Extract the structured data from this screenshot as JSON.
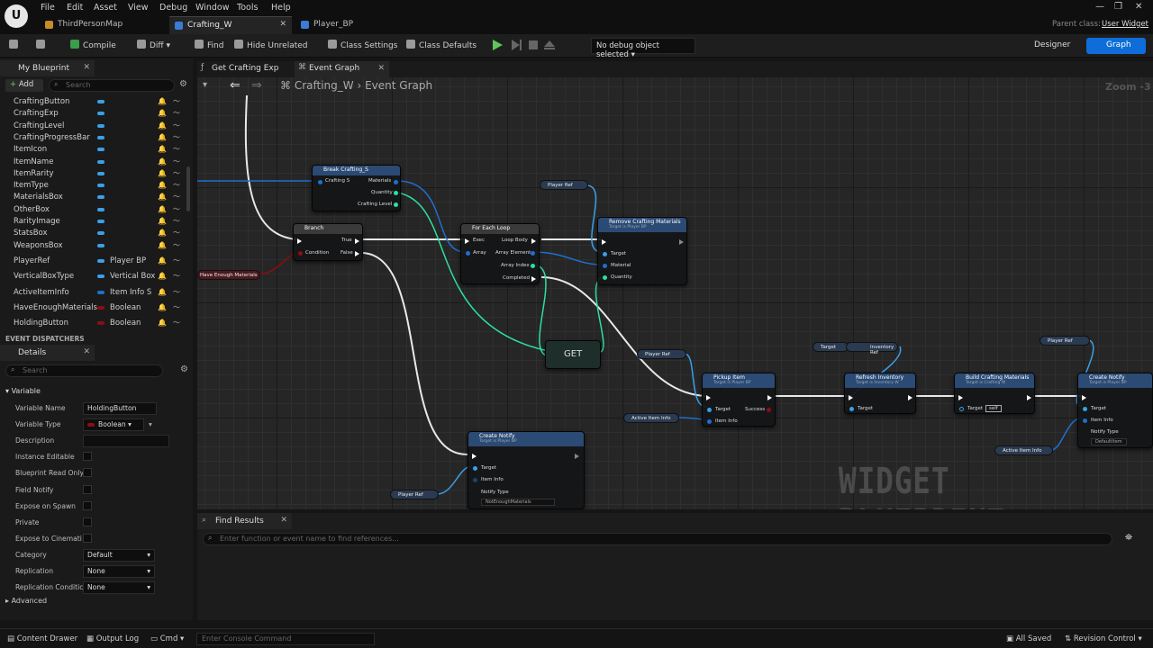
{
  "menu": [
    "File",
    "Edit",
    "Asset",
    "View",
    "Debug",
    "Window",
    "Tools",
    "Help"
  ],
  "tabs": [
    {
      "label": "ThirdPersonMap",
      "color": "#c58a2a"
    },
    {
      "label": "Crafting_W",
      "color": "#3a7bd5"
    },
    {
      "label": "Player_BP",
      "color": "#3a7bd5"
    }
  ],
  "parent_class_label": "Parent class:",
  "parent_class_value": "User Widget",
  "toolbar": {
    "compile": "Compile",
    "diff": "Diff",
    "find": "Find",
    "hide_unrelated": "Hide Unrelated",
    "class_settings": "Class Settings",
    "class_defaults": "Class Defaults",
    "debug_object": "No debug object selected",
    "designer": "Designer",
    "graph": "Graph"
  },
  "my_blueprint": {
    "title": "My Blueprint",
    "add": "Add",
    "search_placeholder": "Search",
    "widgets": [
      "CraftingButton",
      "CraftingExp",
      "CraftingLevel",
      "CraftingProgressBar",
      "ItemIcon",
      "ItemName",
      "ItemRarity",
      "ItemType",
      "MaterialsBox",
      "OtherBox",
      "RarityImage",
      "StatsBox",
      "WeaponsBox"
    ],
    "variables": [
      {
        "name": "PlayerRef",
        "type": "Player BP",
        "color": "#3aa0e8"
      },
      {
        "name": "VerticalBoxType",
        "type": "Vertical Box",
        "color": "#3aa0e8"
      },
      {
        "name": "ActiveItemInfo",
        "type": "Item Info S",
        "color": "#1f6fd0"
      },
      {
        "name": "HaveEnoughMaterials",
        "type": "Boolean",
        "color": "#8c0d12"
      },
      {
        "name": "HoldingButton",
        "type": "Boolean",
        "color": "#8c0d12"
      }
    ],
    "dispatchers": "EVENT DISPATCHERS"
  },
  "details": {
    "title": "Details",
    "search_placeholder": "Search",
    "section": "Variable",
    "advanced": "Advanced",
    "rows": [
      {
        "label": "Variable Name",
        "value": "HoldingButton",
        "kind": "text"
      },
      {
        "label": "Variable Type",
        "value": "Boolean",
        "kind": "type"
      },
      {
        "label": "Description",
        "value": "",
        "kind": "text"
      },
      {
        "label": "Instance Editable",
        "value": "",
        "kind": "check"
      },
      {
        "label": "Blueprint Read Only",
        "value": "",
        "kind": "check"
      },
      {
        "label": "Field Notify",
        "value": "",
        "kind": "check"
      },
      {
        "label": "Expose on Spawn",
        "value": "",
        "kind": "check"
      },
      {
        "label": "Private",
        "value": "",
        "kind": "check"
      },
      {
        "label": "Expose to Cinemati",
        "value": "",
        "kind": "check"
      },
      {
        "label": "Category",
        "value": "Default",
        "kind": "select"
      },
      {
        "label": "Replication",
        "value": "None",
        "kind": "select"
      },
      {
        "label": "Replication Conditic",
        "value": "None",
        "kind": "select"
      }
    ]
  },
  "graph_tabs": [
    "Get Crafting Exp",
    "Event Graph"
  ],
  "breadcrumb": {
    "root": "Crafting_W",
    "current": "Event Graph"
  },
  "zoom": "Zoom -3",
  "watermark": "WIDGET BLUEPRINT",
  "nodes": {
    "break": {
      "title": "Break Crafting_S",
      "pins_in": [
        "Crafting S"
      ],
      "pins_out": [
        "Materials",
        "Quantity",
        "Crafting Level"
      ]
    },
    "branch": {
      "title": "Branch",
      "pins_in": [
        "Condition"
      ],
      "pins_out": [
        "True",
        "False"
      ]
    },
    "foreach": {
      "title": "For Each Loop",
      "pins_in": [
        "Exec",
        "Array"
      ],
      "pins_out": [
        "Loop Body",
        "Array Element",
        "Array Index",
        "Completed"
      ]
    },
    "remove": {
      "title": "Remove Crafting Materials",
      "sub": "Target is Player BP",
      "pins": [
        "Target",
        "Material",
        "Quantity"
      ]
    },
    "get": "GET",
    "pickup": {
      "title": "Pickup Item",
      "sub": "Target is Player BP",
      "pins": [
        "Target",
        "Item Info"
      ],
      "out": "Success"
    },
    "refresh": {
      "title": "Refresh Inventory",
      "sub": "Target is Inventory W",
      "pins": [
        "Target"
      ]
    },
    "build": {
      "title": "Build Crafting Materials",
      "sub": "Target is Crafting W",
      "pins": [
        "Target"
      ],
      "self": "self"
    },
    "notify1": {
      "title": "Create Notify",
      "sub": "Target is Player BP",
      "pins": [
        "Target",
        "Item Info"
      ],
      "notify_label": "Notify Type",
      "notify_value": "DefaultItem"
    },
    "notify2": {
      "title": "Create Notify",
      "sub": "Target is Player BP",
      "pins": [
        "Target",
        "Item Info"
      ],
      "notify_label": "Notify Type",
      "notify_value": "NotEnoughMaterials"
    },
    "vars": [
      "Player Ref",
      "Have Enough Materials",
      "Player Ref",
      "Target",
      "Inventory Ref",
      "Player Ref",
      "Active Item Info",
      "Active Item Info",
      "Player Ref"
    ]
  },
  "find_results": {
    "title": "Find Results",
    "placeholder": "Enter function or event name to find references..."
  },
  "status": {
    "content_drawer": "Content Drawer",
    "output_log": "Output Log",
    "cmd": "Cmd",
    "console_placeholder": "Enter Console Command",
    "saved": "All Saved",
    "revision": "Revision Control"
  }
}
